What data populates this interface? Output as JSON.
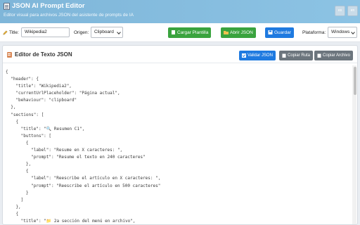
{
  "app": {
    "title": "JSON AI Prompt Editor",
    "subtitle": "Editor visual para archivos JSON del asistente de prompts de IA",
    "lang_buttons": [
      "es",
      "en"
    ]
  },
  "toolbar": {
    "title_label": "Title:",
    "title_value": "Wikipedia2",
    "origin_label": "Origen:",
    "origin_value": "Clipboard",
    "load_template": "Cargar Plantilla",
    "open_json": "Abrir JSON",
    "save": "Guardar",
    "platform_label": "Plataforma:",
    "platform_value": "Windows"
  },
  "editor": {
    "title": "Editor de Texto JSON",
    "validate": "Validar JSON",
    "copy_path": "Copiar Ruta",
    "copy_file": "Copiar Archivo",
    "content": "{\n  \"header\": {\n    \"title\": \"Wikipedia2\",\n    \"currentUrlPlaceholder\": \"Página actual\",\n    \"behaviour\": \"clipboard\"\n  },\n  \"sections\": [\n    {\n      \"title\": \"🔍 Resumen C1\",\n      \"buttons\": [\n        {\n          \"label\": \"Resume en X caracteres: \",\n          \"prompt\": \"Resume el texto en 240 caracteres\"\n        },\n        {\n          \"label\": \"Reescribe el artículo en X caracteres: \",\n          \"prompt\": \"Reescribe el artículo en 500 caracteres\"\n        }\n      ]\n    },\n    {\n      \"title\": \"📁 2a sección del menú en archivo\",\n      \"buttons\": [\n        {\n          \"label\": \"Cambiar idioma AI\","
  },
  "colors": {
    "header": "#8cc3e4",
    "green_button": "#3aa33e",
    "blue_button": "#1f7ae0",
    "gray_button": "#6c757d"
  }
}
